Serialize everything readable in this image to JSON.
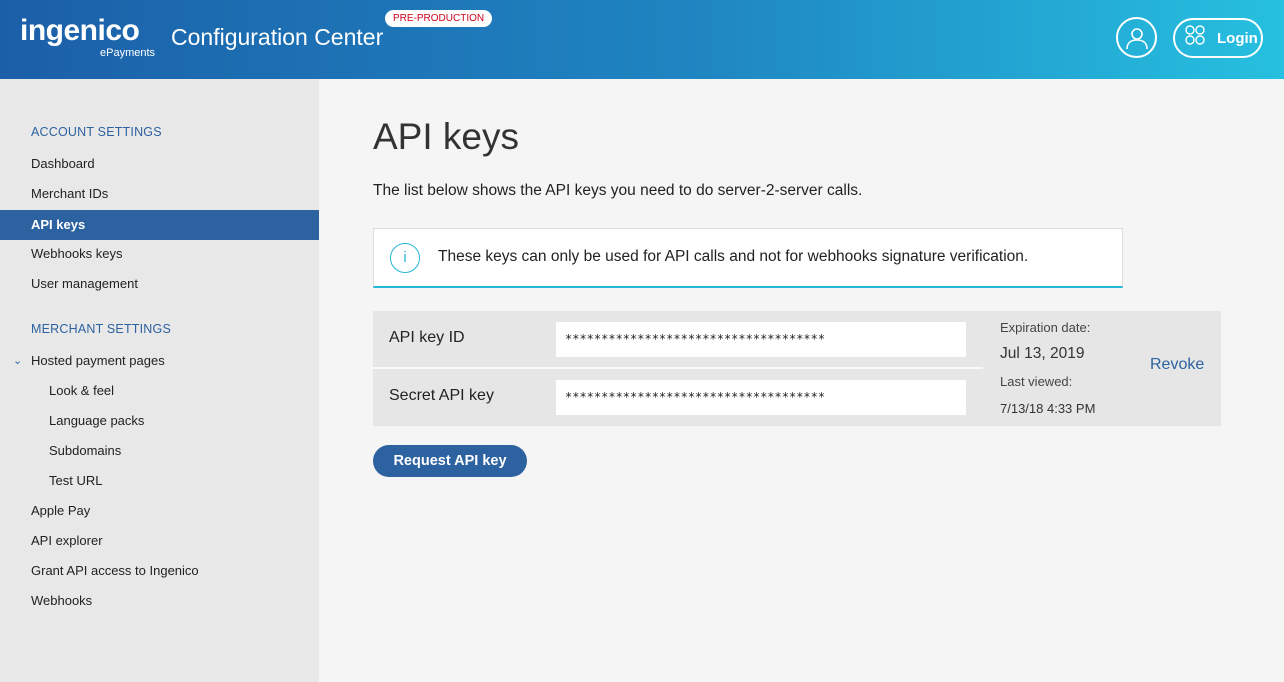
{
  "header": {
    "logo": "ingenico",
    "logo_sub": "ePayments",
    "app_title": "Configuration Center",
    "env_badge": "PRE-PRODUCTION",
    "login_label": "Login",
    "user_icon": "user-icon",
    "apps_icon": "apps-grid-icon"
  },
  "sidebar": {
    "account_title": "ACCOUNT SETTINGS",
    "account_items": [
      "Dashboard",
      "Merchant IDs",
      "API keys",
      "Webhooks keys",
      "User management"
    ],
    "merchant_title": "MERCHANT SETTINGS",
    "hosted_label": "Hosted payment pages",
    "hosted_sub": [
      "Look & feel",
      "Language packs",
      "Subdomains",
      "Test URL"
    ],
    "other_items": [
      "Apple Pay",
      "API explorer",
      "Grant API access to Ingenico",
      "Webhooks"
    ],
    "active_item": "API keys"
  },
  "main": {
    "title": "API keys",
    "intro": "The list below shows the API keys you need to do server-2-server calls.",
    "info": "These keys can only be used for API calls and not for webhooks signature verification.",
    "key_id_label": "API key ID",
    "key_id_value": "************************************",
    "secret_label": "Secret API key",
    "secret_value": "************************************",
    "expiration_label": "Expiration date:",
    "expiration_value": "Jul 13, 2019",
    "last_viewed_label": "Last viewed:",
    "last_viewed_value": "7/13/18 4:33 PM",
    "revoke_label": "Revoke",
    "request_label": "Request API key"
  },
  "colors": {
    "brand": "#2d62a0",
    "accent": "#26b6d9",
    "badge": "#d0021b"
  }
}
